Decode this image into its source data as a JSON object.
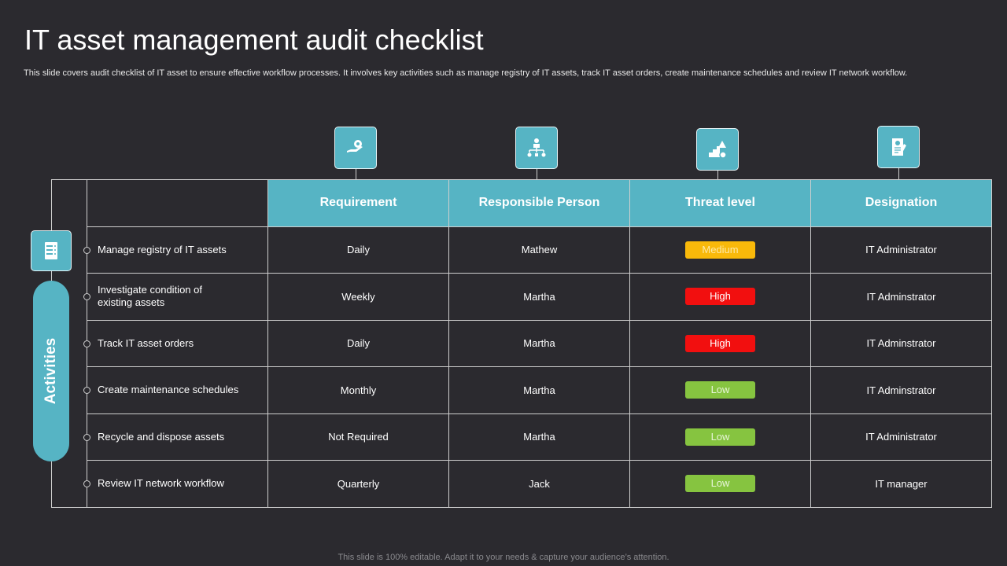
{
  "title": "IT asset management audit checklist",
  "subtitle": "This slide covers audit checklist of IT asset to ensure effective workflow processes. It involves key activities such as manage registry of IT assets, track IT asset orders, create maintenance schedules and review IT network workflow.",
  "footer": "This slide is 100% editable. Adapt it to your needs & capture your audience’s attention.",
  "side_label": "Activities",
  "colors": {
    "accent": "#56b4c4",
    "medium": "#f9b90a",
    "high": "#f20f0f",
    "low": "#86c440"
  },
  "columns": [
    {
      "label": "Requirement",
      "icon": "hand-gear-icon"
    },
    {
      "label": "Responsible  Person",
      "icon": "org-chart-icon"
    },
    {
      "label": "Threat level",
      "icon": "risk-stairs-icon"
    },
    {
      "label": "Designation",
      "icon": "certificate-icon"
    }
  ],
  "rows": [
    {
      "activity": "Manage registry of IT assets",
      "requirement": "Daily",
      "person": "Mathew",
      "threat": "Medium",
      "level": "medium",
      "designation": "IT Administrator"
    },
    {
      "activity": "Investigate  condition of existing assets",
      "requirement": "Weekly",
      "person": "Martha",
      "threat": "High",
      "level": "high",
      "designation": "IT Adminstrator"
    },
    {
      "activity": "Track IT asset orders",
      "requirement": "Daily",
      "person": "Martha",
      "threat": "High",
      "level": "high",
      "designation": "IT Adminstrator"
    },
    {
      "activity": "Create maintenance schedules",
      "requirement": "Monthly",
      "person": "Martha",
      "threat": "Low",
      "level": "low",
      "designation": "IT Adminstrator"
    },
    {
      "activity": "Recycle and dispose assets",
      "requirement": "Not Required",
      "person": "Martha",
      "threat": "Low",
      "level": "low",
      "designation": "IT Administrator"
    },
    {
      "activity": "Review  IT  network workflow",
      "requirement": "Quarterly",
      "person": "Jack",
      "threat": "Low",
      "level": "low",
      "designation": "IT manager"
    }
  ]
}
